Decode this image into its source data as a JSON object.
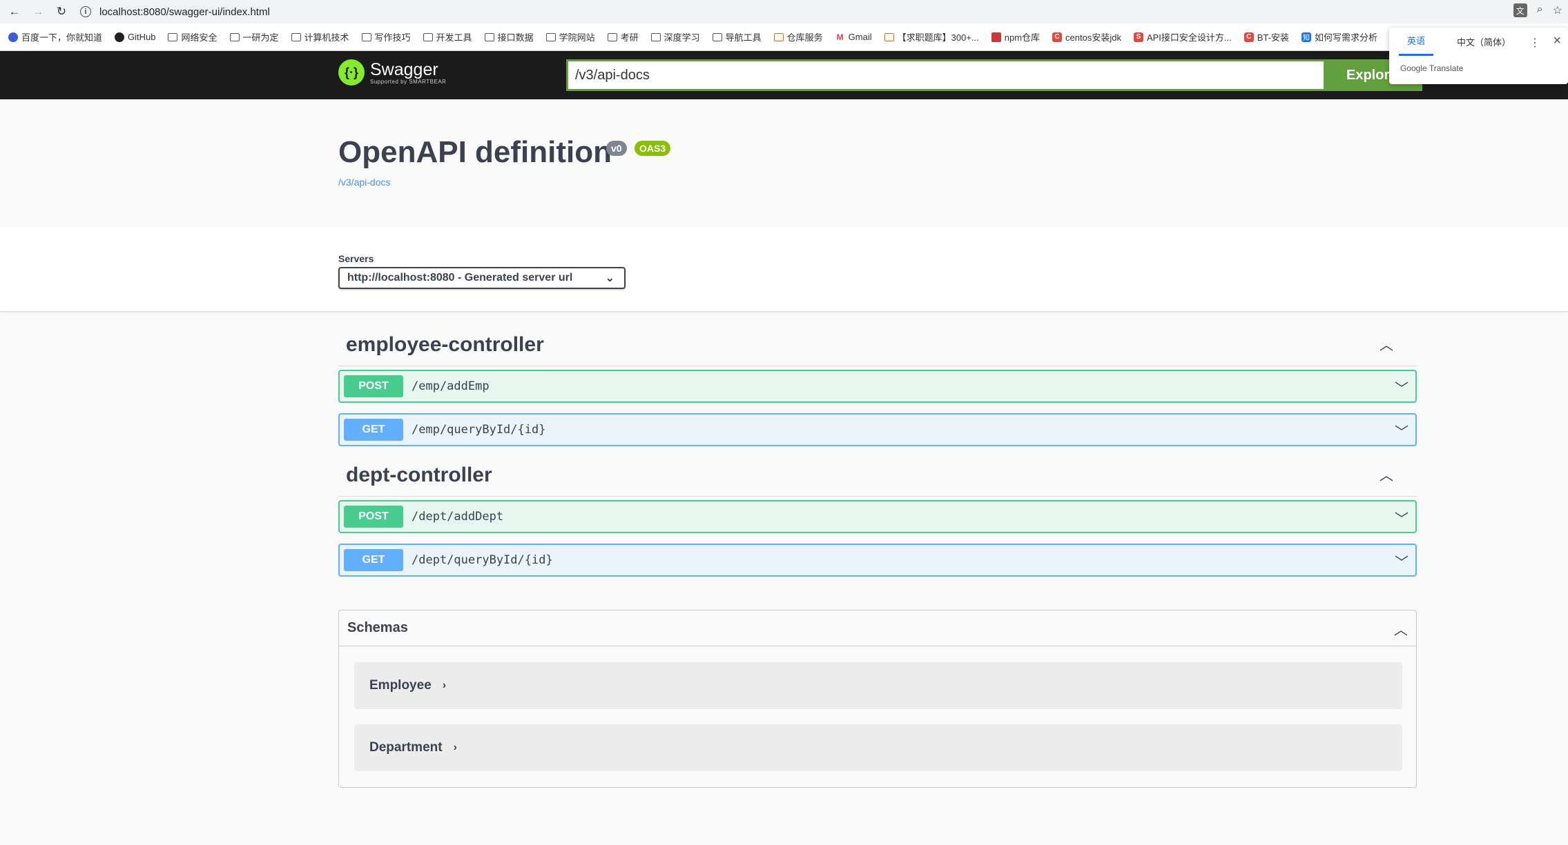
{
  "browser": {
    "url": "localhost:8080/swagger-ui/index.html",
    "bookmarks": [
      {
        "label": "百度一下，你就知道",
        "icon": "baidu-icon"
      },
      {
        "label": "GitHub",
        "icon": "github-icon"
      },
      {
        "label": "网络安全",
        "icon": "folder-icon"
      },
      {
        "label": "一研为定",
        "icon": "folder-icon"
      },
      {
        "label": "计算机技术",
        "icon": "folder-icon"
      },
      {
        "label": "写作技巧",
        "icon": "folder-icon"
      },
      {
        "label": "开发工具",
        "icon": "folder-icon"
      },
      {
        "label": "接口数据",
        "icon": "folder-icon"
      },
      {
        "label": "学院网站",
        "icon": "folder-icon"
      },
      {
        "label": "考研",
        "icon": "folder-icon"
      },
      {
        "label": "深度学习",
        "icon": "folder-icon"
      },
      {
        "label": "导航工具",
        "icon": "folder-icon"
      },
      {
        "label": "仓库服务",
        "icon": "repo-icon"
      },
      {
        "label": "Gmail",
        "icon": "gmail-icon"
      },
      {
        "label": "【求职题库】300+...",
        "icon": "niuke-icon"
      },
      {
        "label": "npm仓库",
        "icon": "npm-icon"
      },
      {
        "label": "centos安装jdk",
        "icon": "csdn-icon"
      },
      {
        "label": "API接口安全设计方...",
        "icon": "api-icon"
      },
      {
        "label": "BT-安装",
        "icon": "csdn-icon"
      },
      {
        "label": "如何写需求分析",
        "icon": "zhihu-icon"
      }
    ],
    "translate_popup": {
      "tabs": [
        "英语",
        "中文（简体）"
      ],
      "active_tab": 0,
      "footer": "Google Translate"
    }
  },
  "swagger": {
    "logo": {
      "name": "Swagger",
      "tagline": "Supported by SMARTBEAR"
    },
    "api_url": "/v3/api-docs",
    "explore_label": "Explore",
    "info": {
      "title": "OpenAPI definition",
      "version": "v0",
      "oas": "OAS3",
      "link": "/v3/api-docs"
    },
    "servers": {
      "label": "Servers",
      "selected": "http://localhost:8080 - Generated server url"
    },
    "tags": [
      {
        "name": "employee-controller",
        "operations": [
          {
            "method": "POST",
            "path": "/emp/addEmp"
          },
          {
            "method": "GET",
            "path": "/emp/queryById/{id}"
          }
        ]
      },
      {
        "name": "dept-controller",
        "operations": [
          {
            "method": "POST",
            "path": "/dept/addDept"
          },
          {
            "method": "GET",
            "path": "/dept/queryById/{id}"
          }
        ]
      }
    ],
    "schemas": {
      "title": "Schemas",
      "models": [
        "Employee",
        "Department"
      ]
    }
  },
  "colors": {
    "post": "#49cc90",
    "get": "#61affe",
    "topbar": "#1b1b1b",
    "accent": "#62a03f"
  }
}
